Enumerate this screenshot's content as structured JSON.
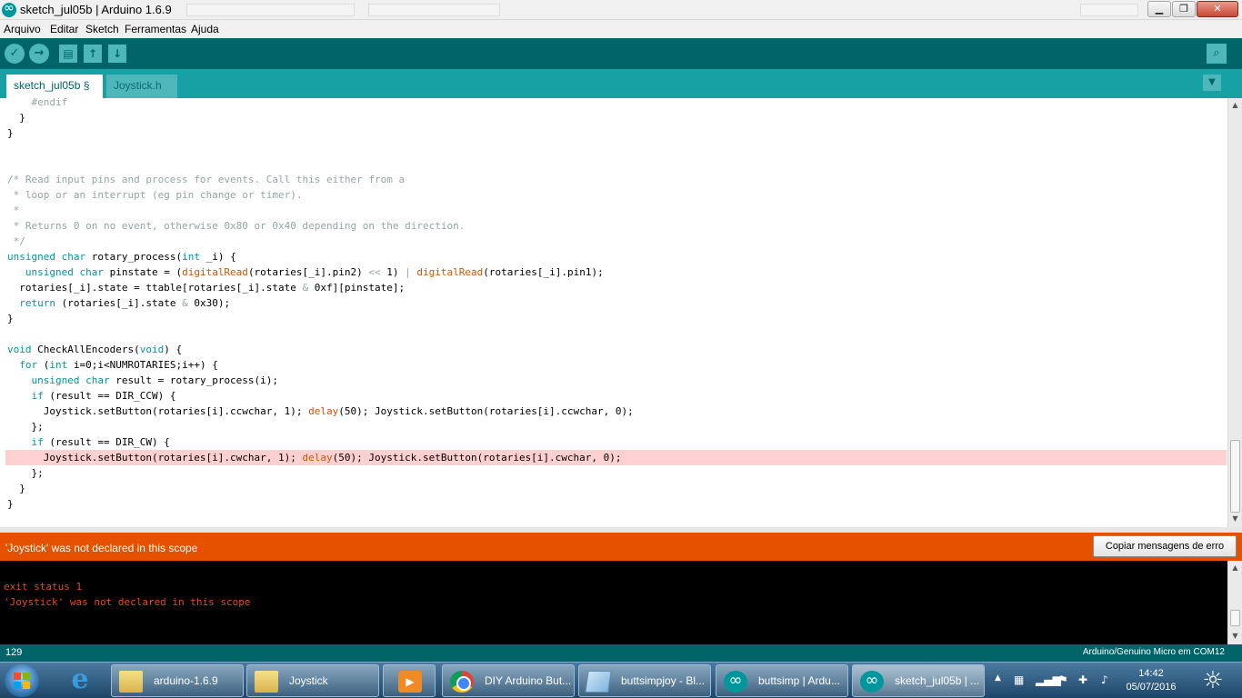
{
  "window": {
    "title": "sketch_jul05b | Arduino 1.6.9",
    "minimize": "▁",
    "maximize": "❐",
    "close": "✕"
  },
  "menu": {
    "items": [
      "Arquivo",
      "Editar",
      "Sketch",
      "Ferramentas",
      "Ajuda"
    ]
  },
  "toolbar": {
    "verify_icon": "✓",
    "upload_icon": "→",
    "new_icon": "▤",
    "open_icon": "↑",
    "save_icon": "↓",
    "serial_monitor_icon": "⌕"
  },
  "tabs": [
    {
      "label": "sketch_jul05b §"
    },
    {
      "label": "Joystick.h §"
    }
  ],
  "tab_menu_icon": "▼",
  "code_lines": [
    "    #endif",
    "  }",
    "}",
    "",
    "",
    "/* Read input pins and process for events. Call this either from a",
    " * loop or an interrupt (eg pin change or timer).",
    " *",
    " * Returns 0 on no event, otherwise 0x80 or 0x40 depending on the direction.",
    " */",
    "unsigned char rotary_process(int _i) {",
    "   unsigned char pinstate = (digitalRead(rotaries[_i].pin2) << 1) | digitalRead(rotaries[_i].pin1);",
    "  rotaries[_i].state = ttable[rotaries[_i].state & 0xf][pinstate];",
    "  return (rotaries[_i].state & 0x30);",
    "}",
    "",
    "void CheckAllEncoders(void) {",
    "  for (int i=0;i<NUMROTARIES;i++) {",
    "    unsigned char result = rotary_process(i);",
    "    if (result == DIR_CCW) {",
    "      Joystick.setButton(rotaries[i].ccwchar, 1); delay(50); Joystick.setButton(rotaries[i].ccwchar, 0);",
    "    };",
    "    if (result == DIR_CW) {",
    "      Joystick.setButton(rotaries[i].cwchar, 1); delay(50); Joystick.setButton(rotaries[i].cwchar, 0);",
    "    };",
    "  }",
    "}"
  ],
  "highlighted_line_index": 23,
  "error": {
    "message": "'Joystick' was not declared in this scope",
    "copy_button": "Copiar mensagens de erro"
  },
  "console": {
    "lines": [
      "exit status 1",
      "'Joystick' was not declared in this scope"
    ]
  },
  "status": {
    "line_number": "129",
    "board": "Arduino/Genuino Micro em COM12"
  },
  "taskbar": {
    "items": [
      {
        "label": "arduino-1.6.9",
        "icon": "folder-icon"
      },
      {
        "label": "Joystick",
        "icon": "folder-icon"
      },
      {
        "label": "",
        "icon": "media-player-icon"
      },
      {
        "label": "DIY Arduino But...",
        "icon": "chrome-icon"
      },
      {
        "label": "buttsimpjoy - Bl...",
        "icon": "notepad-icon"
      },
      {
        "label": "buttsimp | Ardu...",
        "icon": "arduino-icon"
      },
      {
        "label": "sketch_jul05b | ...",
        "icon": "arduino-icon"
      }
    ],
    "time": "14:42",
    "date": "05/07/2016"
  },
  "colors": {
    "toolbar": "#006468",
    "tabbar": "#17a1a5",
    "error": "#e65100",
    "keyword": "#00979c",
    "function": "#d35400",
    "comment": "#95a5a6",
    "highlight": "#ffd0d0"
  }
}
